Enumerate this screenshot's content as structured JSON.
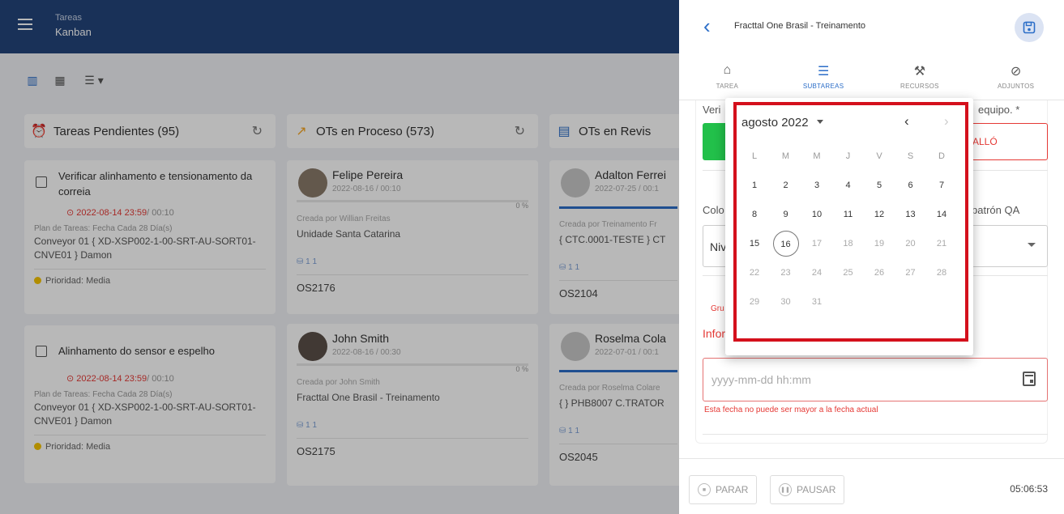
{
  "app": {
    "section": "Tareas",
    "view": "Kanban"
  },
  "view_icons": [
    "columns-icon",
    "calendar-icon",
    "list-icon"
  ],
  "columns": [
    {
      "title": "Tareas Pendientes (95)",
      "icon": "alarm-icon",
      "color": "#e53935"
    },
    {
      "title": "OTs en Proceso (573)",
      "icon": "trend-icon",
      "color": "#f5a623"
    },
    {
      "title": "OTs en Revis",
      "icon": "clipboard-icon",
      "color": "#2c6ec8"
    }
  ],
  "pending_cards": [
    {
      "title": "Verificar alinhamento e tensionamento da correia",
      "due": "2022-08-14 23:59",
      "due_extra": "/ 00:10",
      "plan": "Plan de Tareas: Fecha Cada 28 Día(s)",
      "asset": "Conveyor 01 { XD-XSP002-1-00-SRT-AU-SORT01-CNVE01 } Damon",
      "priority": "Prioridad: Media"
    },
    {
      "title": "Alinhamento do sensor e espelho",
      "due": "2022-08-14 23:59",
      "due_extra": "/ 00:10",
      "plan": "Plan de Tareas: Fecha Cada 28 Día(s)",
      "asset": "Conveyor 01 { XD-XSP002-1-00-SRT-AU-SORT01-CNVE01 } Damon",
      "priority": "Prioridad: Media"
    }
  ],
  "process_cards": [
    {
      "name": "Felipe Pereira",
      "date": "2022-08-16 / 00:10",
      "progress_text": "0 %",
      "progress": 0,
      "by": "Creada por Willian Freitas",
      "loc": "Unidade Santa Catarina",
      "counts": "1  1",
      "os": "OS2176"
    },
    {
      "name": "John Smith",
      "date": "2022-08-16 / 00:30",
      "progress_text": "0 %",
      "progress": 0,
      "by": "Creada por John Smith",
      "loc": "Fracttal One Brasil - Treinamento",
      "counts": "1  1",
      "os": "OS2175"
    }
  ],
  "review_cards": [
    {
      "name": "Adalton Ferrei",
      "date": "2022-07-25 / 00:1",
      "by": "Creada por Treinamento Fr",
      "loc": "{ CTC.0001-TESTE } CT",
      "counts": "1  1",
      "os": "OS2104"
    },
    {
      "name": "Roselma Cola",
      "date": "2022-07-01 / 00:1",
      "by": "Creada por Roselma Colare",
      "loc": "{ } PHB8007 C.TRATOR",
      "counts": "1  1",
      "os": "OS2045"
    }
  ],
  "panel": {
    "title": "Fracttal One Brasil - Treinamento",
    "tabs": [
      {
        "label": "TAREA",
        "icon": "home-icon"
      },
      {
        "label": "SUBTAREAS",
        "icon": "checklist-icon",
        "active": true
      },
      {
        "label": "RECURSOS",
        "icon": "tools-icon"
      },
      {
        "label": "ADJUNTOS",
        "icon": "paperclip-icon"
      }
    ],
    "partial_top_left": "Veri",
    "partial_top_right": "equipo. *",
    "fail_label": "ALLÓ",
    "partial_color": "Colo",
    "partial_qa": "patrón QA",
    "select_value": "Niv",
    "partial_group": "Gru",
    "partial_info": "Infor",
    "date_placeholder": "yyyy-mm-dd hh:mm",
    "date_error": "Esta fecha no puede ser mayor a la fecha actual",
    "stop_label": "PARAR",
    "pause_label": "PAUSAR",
    "timer": "05:06:53"
  },
  "calendar": {
    "month_label": "agosto 2022",
    "weekdays": [
      "L",
      "M",
      "M",
      "J",
      "V",
      "S",
      "D"
    ],
    "days": [
      [
        "1",
        "2",
        "3",
        "4",
        "5",
        "6",
        "7"
      ],
      [
        "8",
        "9",
        "10",
        "11",
        "12",
        "13",
        "14"
      ],
      [
        "15",
        "16",
        "17",
        "18",
        "19",
        "20",
        "21"
      ],
      [
        "22",
        "23",
        "24",
        "25",
        "26",
        "27",
        "28"
      ],
      [
        "29",
        "30",
        "31"
      ]
    ],
    "selected": "16",
    "enabled_through": "16"
  }
}
